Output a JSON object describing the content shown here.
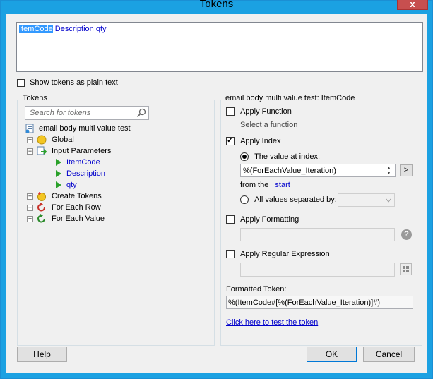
{
  "window": {
    "title": "Tokens",
    "close_glyph": "x"
  },
  "editor": {
    "tokens": [
      "ItemCode",
      "Description",
      "qty"
    ]
  },
  "show_plain": {
    "label": "Show tokens as plain text",
    "checked": false
  },
  "tokens_group": {
    "title": "Tokens",
    "search_placeholder": "Search for tokens",
    "tree": {
      "root": "email body multi value test",
      "global": "Global",
      "input_parameters": "Input Parameters",
      "params": [
        "ItemCode",
        "Description",
        "qty"
      ],
      "create_tokens": "Create Tokens",
      "for_each_row": "For Each Row",
      "for_each_value": "For Each Value"
    }
  },
  "right": {
    "header": "email body multi value test: ItemCode",
    "apply_function": {
      "label": "Apply Function",
      "checked": false,
      "hint": "Select a function"
    },
    "apply_index": {
      "label": "Apply Index",
      "checked": true,
      "value_at_index": {
        "label": "The value at index:",
        "value": "%(ForEachValue_Iteration)",
        "go": ">"
      },
      "from_the": "from the",
      "from_link": "start",
      "all_values": {
        "label": "All values separated by:"
      }
    },
    "apply_formatting": {
      "label": "Apply Formatting",
      "checked": false
    },
    "apply_regex": {
      "label": "Apply Regular Expression",
      "checked": false
    },
    "formatted_label": "Formatted Token:",
    "formatted_value": "%(ItemCode#[%(ForEachValue_Iteration)]#)",
    "test_link": "Click here to test the token"
  },
  "buttons": {
    "help": "Help",
    "ok": "OK",
    "cancel": "Cancel"
  },
  "colors": {
    "titlebar": "#1ba1e2",
    "close": "#c74f4f",
    "selection": "#3399ff",
    "link": "#0000cc"
  }
}
